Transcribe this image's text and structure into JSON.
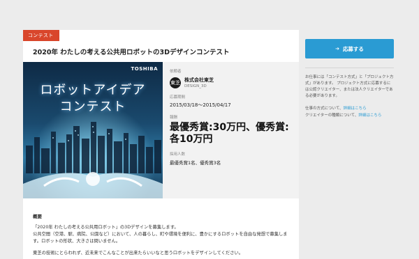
{
  "card": {
    "tag": "コンテスト",
    "title": "2020年 わたしの考える公共用ロボットの3Dデザインコンテスト",
    "banner": {
      "brand": "TOSHIBA",
      "line1": "ロボットアイデア",
      "line2": "コンテスト"
    },
    "info": {
      "client_label": "依頼者",
      "client_logo": "東芝",
      "client_name": "株式会社東芝",
      "client_id": "DESIGN_3D",
      "period_label": "応募期間",
      "period": "2015/03/18〜2015/04/17",
      "reward_label": "報酬",
      "reward": "最優秀賞:30万円、優秀賞:各10万円",
      "count_label": "採用人数",
      "count": "最優秀賞1名、優秀賞3名"
    },
    "overview": {
      "heading": "概要",
      "p1": "「2020年 わたしの考える公共用ロボット」の3Dデザインを募集します。",
      "p2": "公共空間（空港、駅、病院、公園など）において、人の暮らし、町や環境を便利に、豊かにするロボットを自由な発想で募集します。ロボットの形状、大きさは問いません。",
      "p3": "東芝の技術にとらわれず、近未来でこんなことが出来たらいいなと思うロボットをデザインしてください。"
    }
  },
  "sidebar": {
    "apply_label": "応募する",
    "note1": "お仕事には「コンテスト方式」と「プロジェクト方式」があります。 プロジェクト方式に応募するには公認クリエイター、または法人クリエイターである必要があります。",
    "method_text": "仕事の方式について、",
    "method_link": "詳細はこちら",
    "creator_text": "クリエイターの種類について、",
    "creator_link": "詳細はこちら"
  },
  "colors": {
    "tag": "#d9462b",
    "accent": "#2a9bd3"
  }
}
